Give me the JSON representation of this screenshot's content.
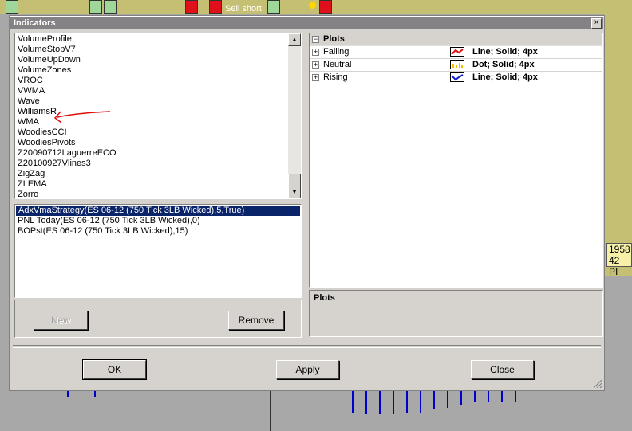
{
  "background_chart": {
    "sell_label": "Sell short",
    "price_label": "1958",
    "time_label": "42 PI"
  },
  "dialog": {
    "title": "Indicators",
    "close_glyph": "×"
  },
  "indicator_list": {
    "items": [
      "VolumeProfile",
      "VolumeStopV7",
      "VolumeUpDown",
      "VolumeZones",
      "VROC",
      "VWMA",
      "Wave",
      "WilliamsR",
      "WMA",
      "WoodiesCCI",
      "WoodiesPivots",
      "Z20090712LaguerreECO",
      "Z20100927Vlines3",
      "ZigZag",
      "ZLEMA",
      "Zorro"
    ],
    "scroll_up_glyph": "▲",
    "scroll_down_glyph": "▼"
  },
  "applied_list": {
    "items": [
      "AdxVmaStrategy(ES 06-12 (750 Tick 3LB Wicked),5,True)",
      "PNL Today(ES 06-12 (750 Tick 3LB Wicked),0)",
      "BOPst(ES 06-12 (750 Tick 3LB Wicked),15)"
    ]
  },
  "buttons": {
    "new": "New",
    "remove": "Remove",
    "ok": "OK",
    "apply": "Apply",
    "close": "Close"
  },
  "properties": {
    "category": "Plots",
    "category_toggle": "−",
    "row_toggle": "+",
    "rows": [
      {
        "name": "Falling",
        "value": "Line; Solid; 4px",
        "color": "#e01010",
        "icon": "line-icon"
      },
      {
        "name": "Neutral",
        "value": "Dot; Solid; 4px",
        "color": "#f0c000",
        "icon": "dot-icon"
      },
      {
        "name": "Rising",
        "value": "Line; Solid; 4px",
        "color": "#1020d0",
        "icon": "line-icon"
      }
    ]
  },
  "description": {
    "title": "Plots"
  }
}
